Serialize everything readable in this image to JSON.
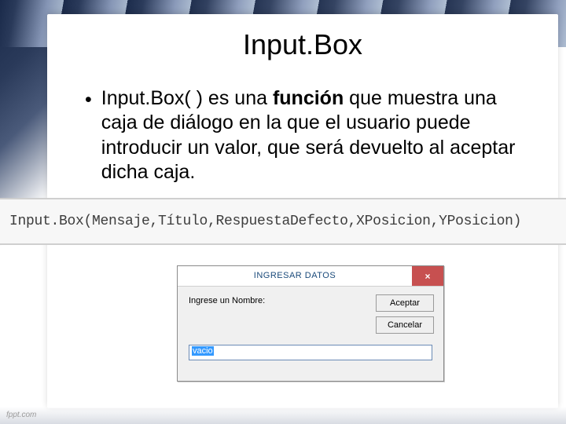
{
  "slide": {
    "title": "Input.Box",
    "bullet_pre": "Input.Box( ) es una ",
    "bullet_bold": "función",
    "bullet_post": " que muestra una caja de diálogo en la que el usuario puede introducir un valor, que será devuelto al aceptar dicha caja."
  },
  "syntax": "Input.Box(Mensaje,Título,RespuestaDefecto,XPosicion,YPosicion)",
  "dialog": {
    "title": "INGRESAR DATOS",
    "close": "×",
    "label": "Ingrese un Nombre:",
    "input_value": "vacio",
    "buttons": {
      "ok": "Aceptar",
      "cancel": "Cancelar"
    }
  },
  "footer": "fppt.com"
}
